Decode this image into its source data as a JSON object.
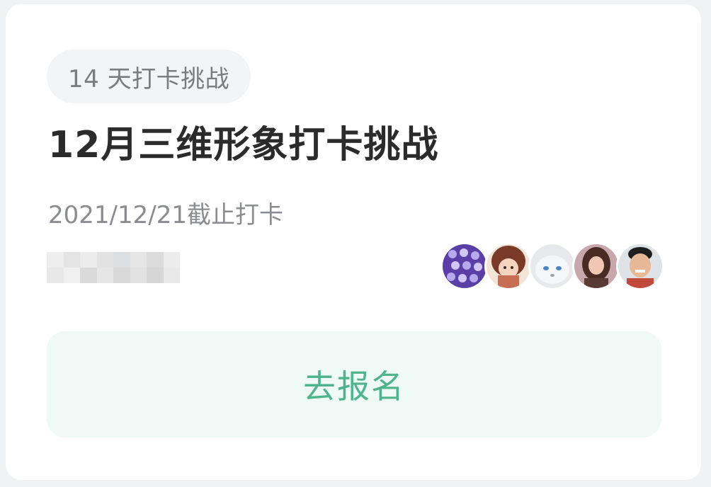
{
  "challenge": {
    "tag_label": "14 天打卡挑战",
    "title": "12月三维形象打卡挑战",
    "deadline_text": "2021/12/21截止打卡",
    "participants": [
      {
        "name": "avatar-1",
        "color": "#5a3fa6"
      },
      {
        "name": "avatar-2",
        "color": "#c76f55"
      },
      {
        "name": "avatar-3",
        "color": "#d7dade"
      },
      {
        "name": "avatar-4",
        "color": "#9a6a63"
      },
      {
        "name": "avatar-5",
        "color": "#c04a3c"
      }
    ],
    "signup_button_label": "去报名"
  },
  "colors": {
    "accent_green": "#4fb48e",
    "button_bg": "#eff9f5"
  }
}
